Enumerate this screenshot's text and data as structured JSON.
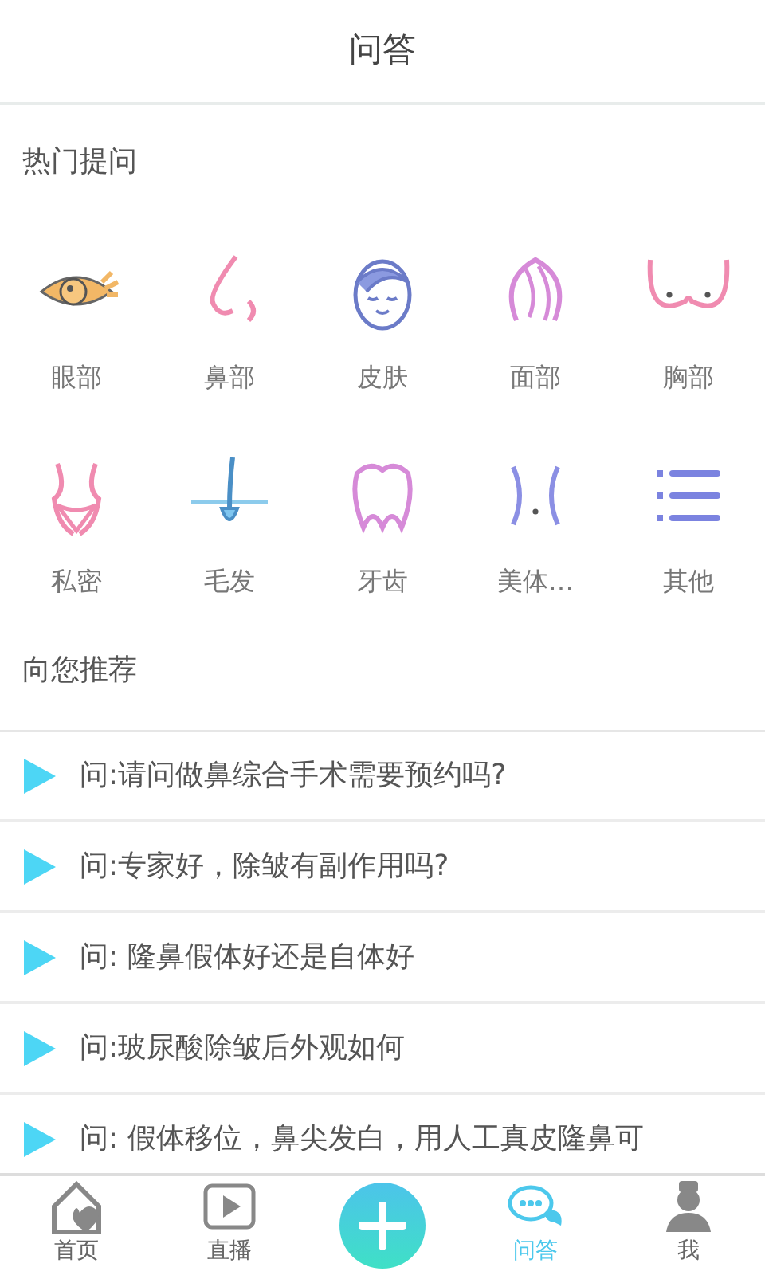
{
  "header": {
    "title": "问答"
  },
  "hot": {
    "title": "热门提问",
    "items": [
      {
        "label": "眼部"
      },
      {
        "label": "鼻部"
      },
      {
        "label": "皮肤"
      },
      {
        "label": "面部"
      },
      {
        "label": "胸部"
      },
      {
        "label": "私密"
      },
      {
        "label": "毛发"
      },
      {
        "label": "牙齿"
      },
      {
        "label": "美体…"
      },
      {
        "label": "其他"
      }
    ]
  },
  "recommend": {
    "title": "向您推荐",
    "questions": [
      "问:请问做鼻综合手术需要预约吗?",
      "问:专家好，除皱有副作用吗?",
      "问: 隆鼻假体好还是自体好",
      "问:玻尿酸除皱后外观如何",
      "问: 假体移位，鼻尖发白，用人工真皮隆鼻可"
    ]
  },
  "tabbar": [
    {
      "kind": "tab",
      "label": "首页",
      "selected": false
    },
    {
      "kind": "tab",
      "label": "直播",
      "selected": false
    },
    {
      "kind": "add"
    },
    {
      "kind": "tab",
      "label": "问答",
      "selected": true
    },
    {
      "kind": "tab",
      "label": "我",
      "selected": false
    }
  ]
}
